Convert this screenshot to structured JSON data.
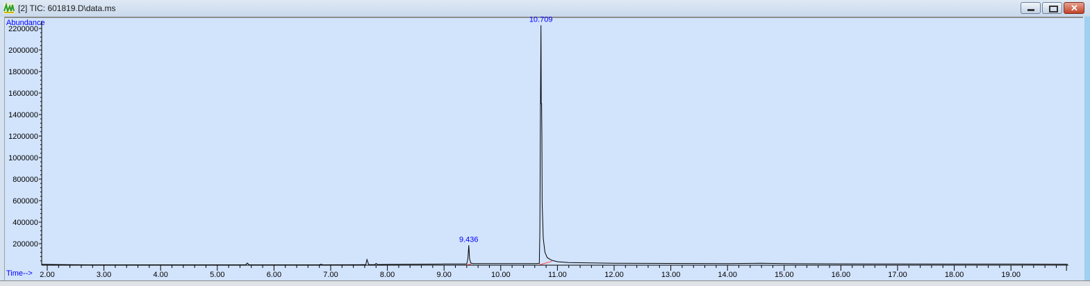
{
  "window": {
    "title": "[2] TIC: 601819.D\\data.ms",
    "icon": "chromatogram-app-icon",
    "buttons": [
      "minimize",
      "maximize",
      "close"
    ]
  },
  "chart_data": {
    "type": "line",
    "title": "",
    "ylabel": "Abundance",
    "xlabel": "Time-->",
    "xlim": [
      1.9,
      20.0
    ],
    "ylim": [
      0,
      2250000
    ],
    "x_ticks": [
      "2.00",
      "3.00",
      "4.00",
      "5.00",
      "6.00",
      "7.00",
      "8.00",
      "9.00",
      "10.00",
      "11.00",
      "12.00",
      "13.00",
      "14.00",
      "15.00",
      "16.00",
      "17.00",
      "18.00",
      "19.00"
    ],
    "y_ticks": [
      "200000",
      "400000",
      "600000",
      "800000",
      "1000000",
      "1200000",
      "1400000",
      "1600000",
      "1800000",
      "2000000",
      "2200000"
    ],
    "grid": false,
    "line_color": "#000000",
    "label_color": "#0000ff",
    "baseline_color": "#ff4040",
    "peak_labels": [
      {
        "rt": "9.436",
        "time": 9.436,
        "abundance": 185000
      },
      {
        "rt": "10.709",
        "time": 10.709,
        "abundance": 2230000
      }
    ],
    "baselines": [
      [
        [
          9.4,
          2000
        ],
        [
          9.48,
          12000
        ]
      ],
      [
        [
          10.68,
          3000
        ],
        [
          10.9,
          35000
        ]
      ]
    ],
    "series": [
      {
        "points": [
          [
            1.9,
            8000
          ],
          [
            2.2,
            6000
          ],
          [
            2.5,
            4000
          ],
          [
            3.0,
            3000
          ],
          [
            4.0,
            3000
          ],
          [
            5.0,
            3000
          ],
          [
            5.5,
            3000
          ],
          [
            5.53,
            20000
          ],
          [
            5.56,
            3000
          ],
          [
            6.0,
            3000
          ],
          [
            6.8,
            3500
          ],
          [
            6.83,
            9000
          ],
          [
            6.86,
            3500
          ],
          [
            7.5,
            4000
          ],
          [
            7.62,
            6000
          ],
          [
            7.64,
            52000
          ],
          [
            7.67,
            6000
          ],
          [
            7.78,
            5000
          ],
          [
            7.8,
            16000
          ],
          [
            7.83,
            6000
          ],
          [
            8.0,
            7000
          ],
          [
            8.5,
            9000
          ],
          [
            9.0,
            11000
          ],
          [
            9.4,
            11000
          ],
          [
            9.42,
            60000
          ],
          [
            9.436,
            185000
          ],
          [
            9.45,
            60000
          ],
          [
            9.47,
            22000
          ],
          [
            9.5,
            15000
          ],
          [
            10.0,
            14000
          ],
          [
            10.6,
            14000
          ],
          [
            10.68,
            16000
          ],
          [
            10.69,
            300000
          ],
          [
            10.7,
            1400000
          ],
          [
            10.709,
            2230000
          ],
          [
            10.715,
            1500000
          ],
          [
            10.72,
            1500000
          ],
          [
            10.725,
            1200000
          ],
          [
            10.73,
            580000
          ],
          [
            10.75,
            250000
          ],
          [
            10.78,
            120000
          ],
          [
            10.82,
            70000
          ],
          [
            10.9,
            45000
          ],
          [
            11.0,
            32000
          ],
          [
            11.2,
            24000
          ],
          [
            12.0,
            18000
          ],
          [
            13.0,
            16000
          ],
          [
            14.0,
            15000
          ],
          [
            14.6,
            18000
          ],
          [
            15.0,
            14000
          ],
          [
            16.0,
            12000
          ],
          [
            17.0,
            11000
          ],
          [
            18.0,
            10000
          ],
          [
            19.0,
            10000
          ],
          [
            20.0,
            9000
          ]
        ]
      }
    ]
  }
}
